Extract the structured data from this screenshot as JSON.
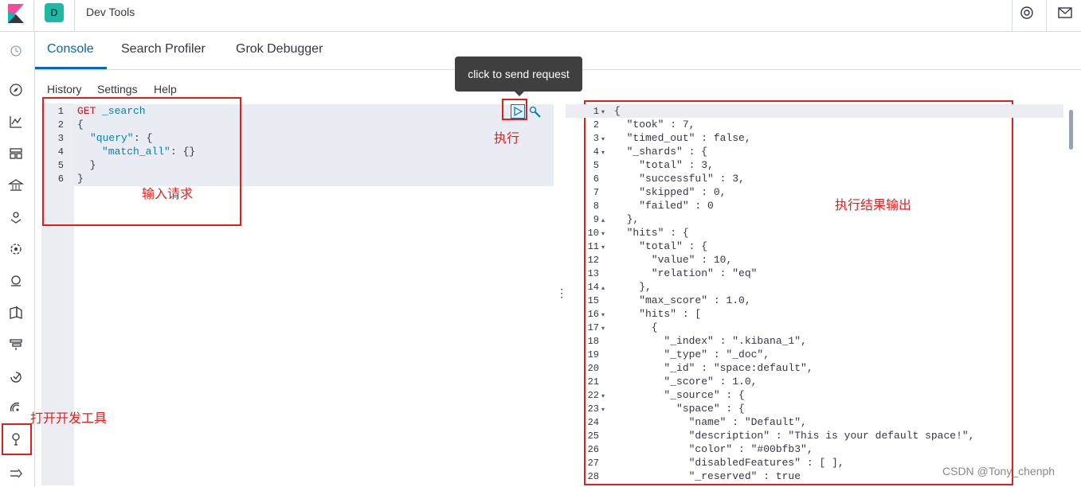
{
  "header": {
    "space_initial": "D",
    "app_title": "Dev Tools"
  },
  "tabs": [
    {
      "label": "Console"
    },
    {
      "label": "Search Profiler"
    },
    {
      "label": "Grok Debugger"
    }
  ],
  "console_menu": {
    "history": "History",
    "settings": "Settings",
    "help": "Help"
  },
  "tooltip": "click to send request",
  "request": {
    "lines": [
      {
        "n": "1",
        "text": ""
      },
      {
        "n": "2",
        "text": "{"
      },
      {
        "n": "3",
        "text": ""
      },
      {
        "n": "4",
        "text": ""
      },
      {
        "n": "5",
        "text": "  }"
      },
      {
        "n": "6",
        "text": "}"
      }
    ],
    "method": "GET",
    "path": "_search",
    "query_key": "\"query\"",
    "query_rest": ": {",
    "match_all_key": "\"match_all\"",
    "match_all_rest": ": {}"
  },
  "annotations": {
    "input_request": "输入请求",
    "execute": "执行",
    "result_output": "执行结果输出",
    "open_dev_tools": "打开开发工具"
  },
  "response_lines": [
    {
      "n": "1",
      "t": "{"
    },
    {
      "n": "2",
      "t": "  \"took\" : 7,"
    },
    {
      "n": "3",
      "t": "  \"timed_out\" : false,"
    },
    {
      "n": "4",
      "t": "  \"_shards\" : {"
    },
    {
      "n": "5",
      "t": "    \"total\" : 3,"
    },
    {
      "n": "6",
      "t": "    \"successful\" : 3,"
    },
    {
      "n": "7",
      "t": "    \"skipped\" : 0,"
    },
    {
      "n": "8",
      "t": "    \"failed\" : 0"
    },
    {
      "n": "9",
      "t": "  },"
    },
    {
      "n": "10",
      "t": "  \"hits\" : {"
    },
    {
      "n": "11",
      "t": "    \"total\" : {"
    },
    {
      "n": "12",
      "t": "      \"value\" : 10,"
    },
    {
      "n": "13",
      "t": "      \"relation\" : \"eq\""
    },
    {
      "n": "14",
      "t": "    },"
    },
    {
      "n": "15",
      "t": "    \"max_score\" : 1.0,"
    },
    {
      "n": "16",
      "t": "    \"hits\" : ["
    },
    {
      "n": "17",
      "t": "      {"
    },
    {
      "n": "18",
      "t": "        \"_index\" : \".kibana_1\","
    },
    {
      "n": "19",
      "t": "        \"_type\" : \"_doc\","
    },
    {
      "n": "20",
      "t": "        \"_id\" : \"space:default\","
    },
    {
      "n": "21",
      "t": "        \"_score\" : 1.0,"
    },
    {
      "n": "22",
      "t": "        \"_source\" : {"
    },
    {
      "n": "23",
      "t": "          \"space\" : {"
    },
    {
      "n": "24",
      "t": "            \"name\" : \"Default\","
    },
    {
      "n": "25",
      "t": "            \"description\" : \"This is your default space!\","
    },
    {
      "n": "26",
      "t": "            \"color\" : \"#00bfb3\","
    },
    {
      "n": "27",
      "t": "            \"disabledFeatures\" : [ ],"
    },
    {
      "n": "28",
      "t": "            \"_reserved\" : true"
    }
  ],
  "watermark": "CSDN @Tony_chenph",
  "colors": {
    "accent": "#006bb4",
    "annotation_red": "#e31c1c",
    "space_avatar": "#20b8a4"
  }
}
